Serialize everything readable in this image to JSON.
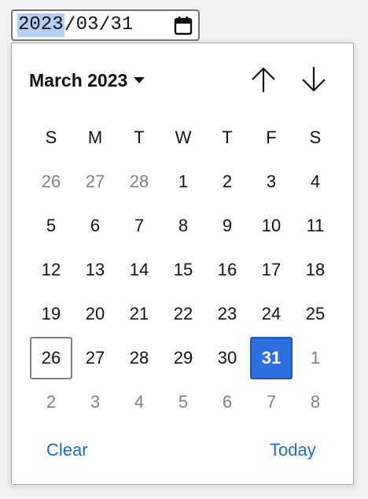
{
  "input": {
    "year": "2023",
    "month": "03",
    "day": "31",
    "separator": "/",
    "calendar_icon": "calendar-icon"
  },
  "picker": {
    "month_label": "March 2023",
    "dropdown_icon": "caret-down-icon",
    "prev_icon": "arrow-up-icon",
    "next_icon": "arrow-down-icon",
    "weekdays": [
      "S",
      "M",
      "T",
      "W",
      "T",
      "F",
      "S"
    ],
    "weeks": [
      [
        {
          "d": "26",
          "other": true
        },
        {
          "d": "27",
          "other": true
        },
        {
          "d": "28",
          "other": true
        },
        {
          "d": "1"
        },
        {
          "d": "2"
        },
        {
          "d": "3"
        },
        {
          "d": "4"
        }
      ],
      [
        {
          "d": "5"
        },
        {
          "d": "6"
        },
        {
          "d": "7"
        },
        {
          "d": "8"
        },
        {
          "d": "9"
        },
        {
          "d": "10"
        },
        {
          "d": "11"
        }
      ],
      [
        {
          "d": "12"
        },
        {
          "d": "13"
        },
        {
          "d": "14"
        },
        {
          "d": "15"
        },
        {
          "d": "16"
        },
        {
          "d": "17"
        },
        {
          "d": "18"
        }
      ],
      [
        {
          "d": "19"
        },
        {
          "d": "20"
        },
        {
          "d": "21"
        },
        {
          "d": "22"
        },
        {
          "d": "23"
        },
        {
          "d": "24"
        },
        {
          "d": "25"
        }
      ],
      [
        {
          "d": "26",
          "today": true
        },
        {
          "d": "27"
        },
        {
          "d": "28"
        },
        {
          "d": "29"
        },
        {
          "d": "30"
        },
        {
          "d": "31",
          "selected": true
        },
        {
          "d": "1",
          "other": true
        }
      ],
      [
        {
          "d": "2",
          "other": true
        },
        {
          "d": "3",
          "other": true
        },
        {
          "d": "4",
          "other": true
        },
        {
          "d": "5",
          "other": true
        },
        {
          "d": "6",
          "other": true
        },
        {
          "d": "7",
          "other": true
        },
        {
          "d": "8",
          "other": true
        }
      ]
    ],
    "clear_label": "Clear",
    "today_label": "Today"
  },
  "colors": {
    "accent": "#1a6bd8",
    "selected_bg": "#2e6fe0",
    "segment_highlight": "#b3cff5"
  }
}
